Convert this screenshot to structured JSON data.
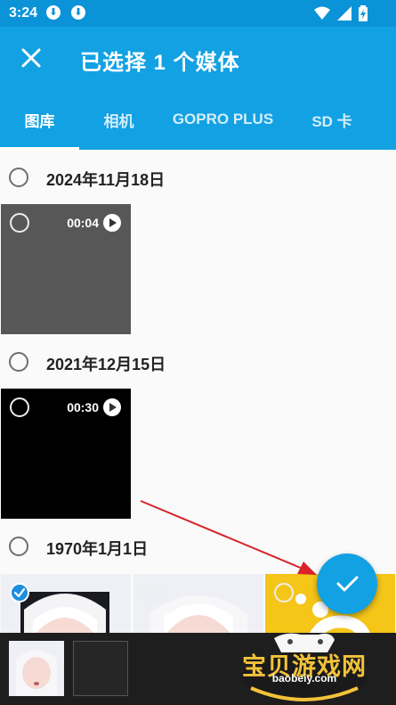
{
  "status_bar": {
    "time": "3:24",
    "download_icons": [
      "download-icon",
      "download-icon"
    ],
    "right_icons": [
      "wifi-icon",
      "signal-icon",
      "battery-charging-icon"
    ]
  },
  "app_bar": {
    "close_icon": "close-icon",
    "title": "已选择 1 个媒体"
  },
  "tabs": [
    {
      "label": "图库",
      "active": true
    },
    {
      "label": "相机",
      "active": false
    },
    {
      "label": "GOPRO PLUS",
      "active": false
    },
    {
      "label": "SD 卡",
      "active": false
    }
  ],
  "groups": [
    {
      "date": "2024年11月18日",
      "items": [
        {
          "type": "video",
          "duration": "00:04",
          "color": "#575757",
          "selected": false
        }
      ]
    },
    {
      "date": "2021年12月15日",
      "items": [
        {
          "type": "video",
          "duration": "00:30",
          "color": "#000000",
          "selected": false
        }
      ]
    },
    {
      "date": "1970年1月1日",
      "items": [
        {
          "type": "photo",
          "selected": true
        },
        {
          "type": "photo",
          "selected": false
        },
        {
          "type": "photo",
          "selected": false
        }
      ]
    }
  ],
  "fab": {
    "icon": "check-icon"
  },
  "watermark": {
    "text": "宝贝游戏网",
    "url": "baobeiy.com"
  },
  "colors": {
    "status_bar": "#0b93d8",
    "app_bar": "#12a1e3",
    "selected": "#1f8ee0",
    "arrow": "#d9222a"
  }
}
